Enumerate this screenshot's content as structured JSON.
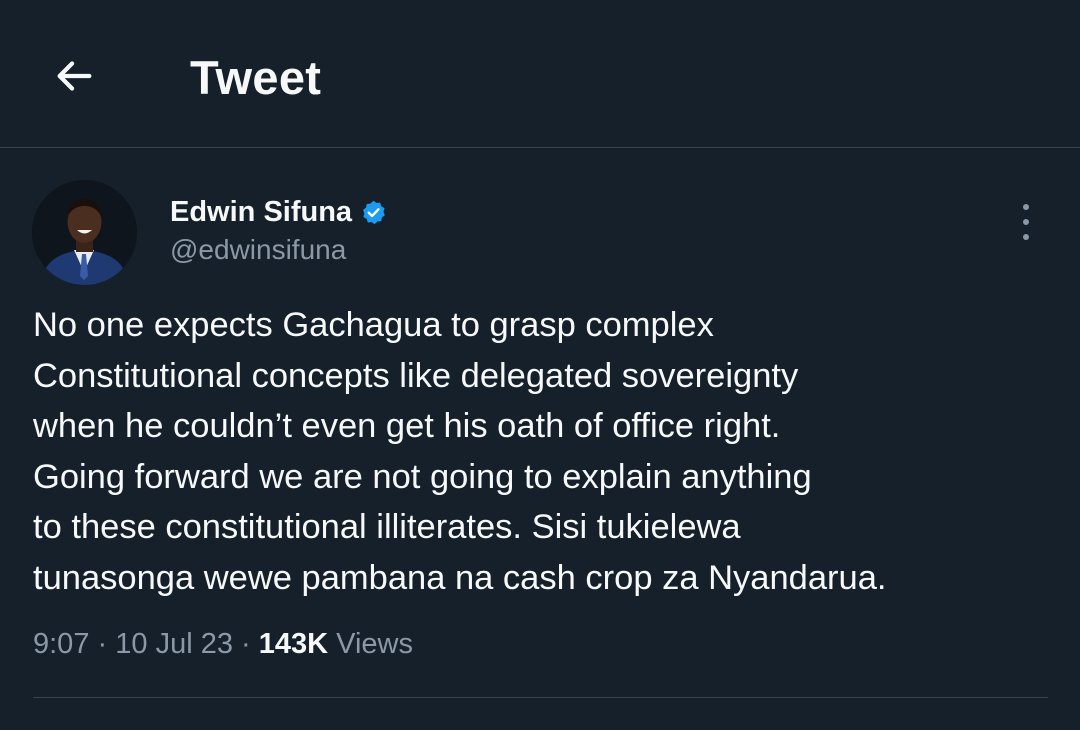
{
  "header": {
    "title": "Tweet",
    "back_icon": "arrow-left-icon"
  },
  "tweet": {
    "author": {
      "name": "Edwin Sifuna",
      "handle": "@edwinsifuna",
      "verified_icon": "verified-badge-icon",
      "verified_color": "#1d9bf0"
    },
    "more_icon": "more-vertical-icon",
    "text_lines": [
      "No one expects Gachagua to grasp complex",
      "Constitutional concepts like delegated sovereignty",
      "when he couldn’t even get his oath of office right.",
      "Going forward we are not going to explain anything",
      "to these constitutional illiterates. Sisi tukielewa",
      "tunasonga wewe pambana na cash crop za Nyandarua."
    ],
    "time": "9:07",
    "separator": "·",
    "date": "10 Jul 23",
    "views_count": "143K",
    "views_label": "Views"
  },
  "colors": {
    "background": "#15202b",
    "text": "#f7f9f9",
    "secondary_text": "#8b98a5",
    "divider": "#38444d"
  }
}
